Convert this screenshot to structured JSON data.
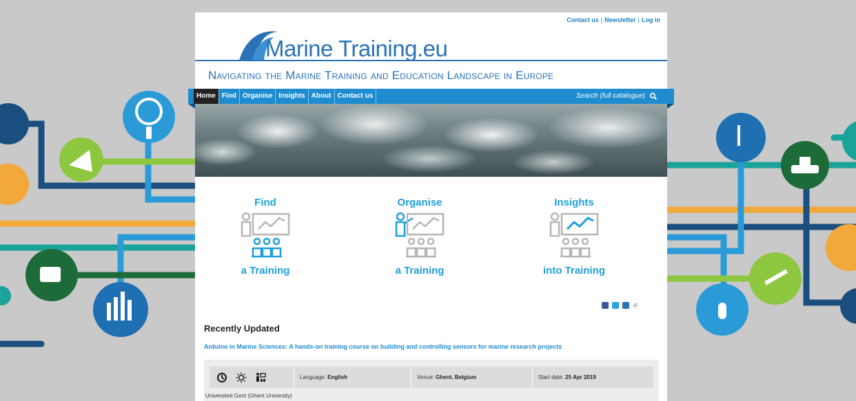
{
  "header": {
    "top_links": [
      "Contact us",
      "Newsletter",
      "Log in"
    ],
    "logo_text": "Marine Training.eu",
    "tagline": "Navigating the Marine Training and Education Landscape in Europe"
  },
  "nav": {
    "items": [
      "Home",
      "Find",
      "Organise",
      "Insights",
      "About",
      "Contact us"
    ],
    "active": "Home",
    "search_placeholder": "Search (full catalogue)"
  },
  "features": [
    {
      "title": "Find",
      "subtitle": "a Training",
      "icon": "find-training-icon"
    },
    {
      "title": "Organise",
      "subtitle": "a Training",
      "icon": "organise-training-icon"
    },
    {
      "title": "Insights",
      "subtitle": "into Training",
      "icon": "insights-training-icon"
    }
  ],
  "social_icons": [
    "facebook-icon",
    "twitter-icon",
    "email-icon",
    "link-icon"
  ],
  "recent": {
    "heading": "Recently Updated",
    "course_title": "Arduino in Marine Sciences: A hands-on training course on building and controlling sensors for marine research projects",
    "language_label": "Language:",
    "language_value": "English",
    "venue_label": "Venue:",
    "venue_value": "Ghent, Belgium",
    "start_label": "Start date:",
    "start_value": "25 Apr 2019",
    "organisation": "Universiteit Gent (Ghent University)"
  },
  "colors": {
    "accent": "#1f8ccf",
    "logo_blue": "#2a72b5",
    "feature_blue": "#1e9fdc",
    "background": "#c9c9c9"
  }
}
